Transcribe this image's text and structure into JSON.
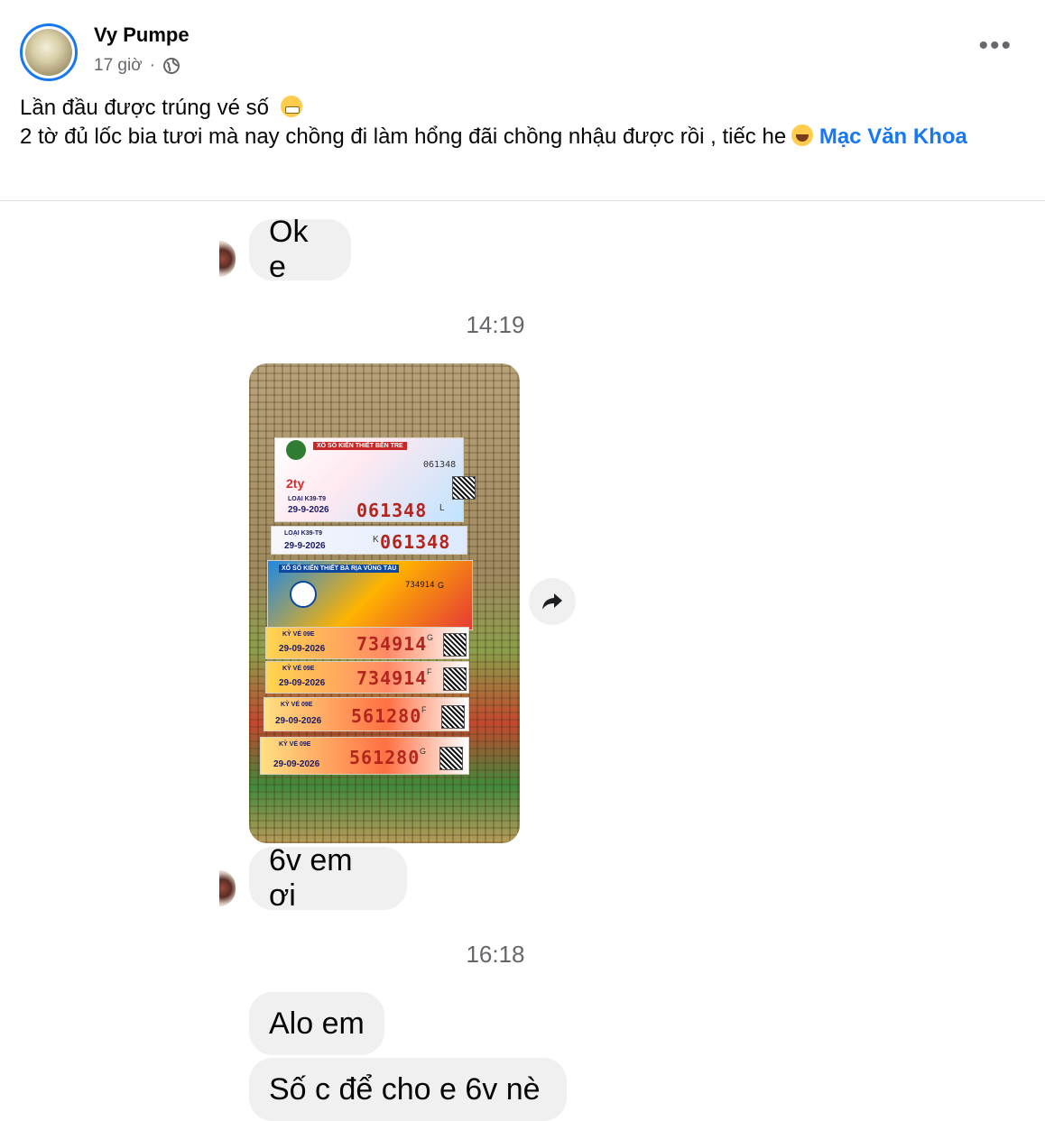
{
  "post": {
    "author": "Vy Pumpe",
    "time": "17 giờ",
    "separator": "·",
    "audience_icon": "globe-icon",
    "more_icon": "more-options-icon",
    "line1": "Lần đầu được trúng vé số",
    "line2": "2 tờ đủ lốc bia tươi mà nay chồng đi làm hổng đãi chồng nhậu được rồi , tiếc he",
    "mention": "Mạc Văn Khoa"
  },
  "chat": {
    "messages": [
      {
        "text": "Ok e"
      },
      {
        "text": "6v em ơi"
      },
      {
        "text": "Alo em"
      },
      {
        "text": "Số c để cho e 6v nè"
      }
    ],
    "timestamps": [
      "14:19",
      "16:18"
    ],
    "share_icon": "forward-share-icon"
  },
  "tickets": [
    {
      "number": "061348",
      "date": "29-9-2026",
      "series": "L",
      "small_number": "061348"
    },
    {
      "number": "061348",
      "date": "29-9-2026",
      "series": "K"
    },
    {
      "header": "XỔ SỐ KIẾN THIẾT BÀ RỊA VŨNG TÀU",
      "small_number": "734914",
      "series": "G"
    },
    {
      "number": "734914",
      "date": "29-09-2026",
      "series": "G"
    },
    {
      "number": "734914",
      "date": "29-09-2026",
      "series": "F"
    },
    {
      "number": "561280",
      "date": "29-09-2026",
      "series": "F"
    },
    {
      "number": "561280",
      "date": "29-09-2026",
      "series": "G"
    }
  ],
  "ticket_header_1": "XỔ SỐ KIẾN THIẾT BẾN TRE",
  "ticket_label_1": "LOẠI K39-T9",
  "ticket_label_2": "KỲ VÉ 09E",
  "colors": {
    "accent": "#1877f2",
    "bubble": "#f0f0f0",
    "muted": "#65676b"
  }
}
